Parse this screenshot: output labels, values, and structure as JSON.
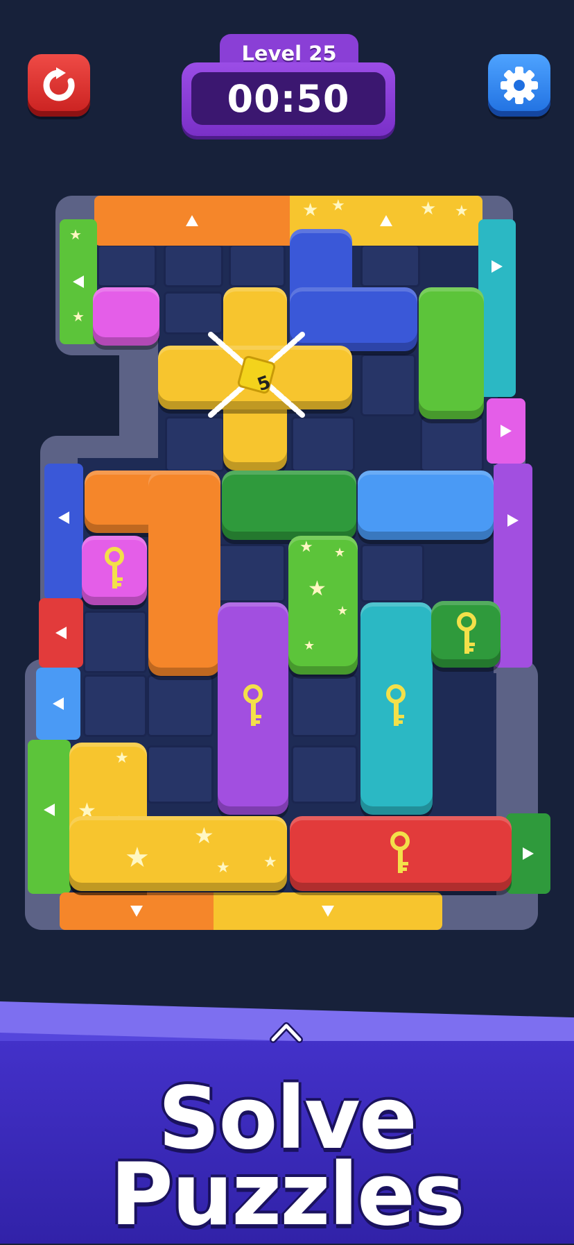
{
  "header": {
    "level_label": "Level 25",
    "timer": "00:50",
    "restart_icon": "restart-icon",
    "settings_icon": "gear-icon"
  },
  "board": {
    "grid_columns": 6,
    "grid_rows": 9,
    "lock": {
      "count": "5",
      "icon": "chain-lock-icon"
    },
    "key_icon": "key-icon"
  },
  "banner": {
    "line1": "Solve",
    "line2": "Puzzles",
    "expand_icon": "chevron-up-icon"
  },
  "colors": {
    "background": "#17213a",
    "red": "#e23b3b",
    "orange": "#f5862a",
    "yellow": "#f7c52e",
    "green": "#5cc43a",
    "dark_green": "#2f9a3c",
    "teal": "#2bb8c4",
    "blue": "#4a9af5",
    "dark_blue": "#3a58d8",
    "purple": "#a24fe0",
    "pink": "#e45ee8",
    "banner": "#4331c9"
  }
}
